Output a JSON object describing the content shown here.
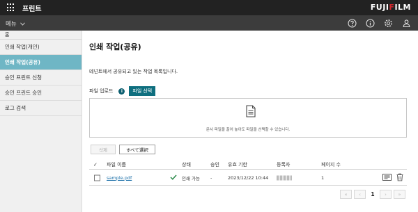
{
  "header": {
    "app_title": "프린트",
    "brand_prefix": "FUJI",
    "brand_accent": "F",
    "brand_suffix": "ILM",
    "brand_color": "#d0262c"
  },
  "subheader": {
    "menu_label": "메뉴",
    "icons": [
      "help-icon",
      "info-icon",
      "settings-icon",
      "user-icon"
    ]
  },
  "sidebar": {
    "home_label": "홈",
    "items": [
      {
        "label": "인쇄 작업(개인)"
      },
      {
        "label": "인쇄 작업(공유)"
      },
      {
        "label": "승인 프린트 신청"
      },
      {
        "label": "승인 프린트 승인"
      },
      {
        "label": "로그 검색"
      }
    ],
    "active_color": "#6fb6c5"
  },
  "main": {
    "title": "인쇄 작업(공유)",
    "description": "테넌트에서 공유되고 있는 작업 목록입니다.",
    "upload_label": "파일 업로드",
    "file_select_label": "파일 선택",
    "dropzone_text": "문서 파일을 끌어 놓아도 파일을 선택할 수 있습니다.",
    "delete_label": "삭제",
    "select_all_label": "すべて選択"
  },
  "table": {
    "headers": {
      "check": "✓",
      "file_name": "파일 이름",
      "status": "상태",
      "approval": "승인",
      "expiry": "유효 기한",
      "registrant": "등록자",
      "pages": "페이지 수"
    },
    "rows": [
      {
        "file_name": "sample.pdf",
        "status": "인쇄 가능",
        "approval": "-",
        "expiry": "2023/12/22 10:44",
        "pages": "1"
      }
    ]
  },
  "pagination": {
    "first": "«",
    "prev": "‹",
    "current": "1",
    "next": "›",
    "last": "»"
  },
  "colors": {
    "topbar": "#222222",
    "subbar": "#3c3c3c",
    "accent_button": "#0f6f7f",
    "check": "#2a8a4a"
  }
}
